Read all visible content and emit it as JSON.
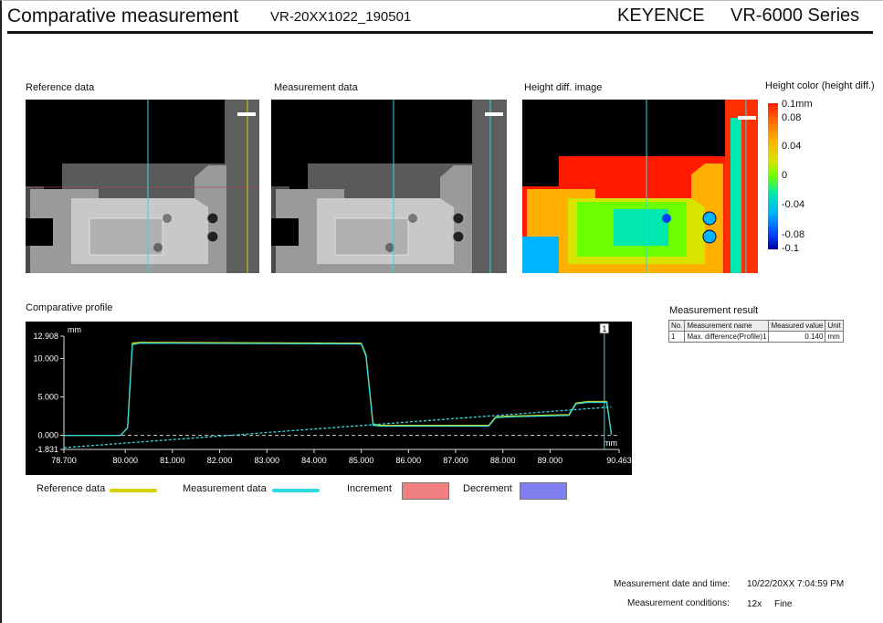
{
  "header": {
    "title": "Comparative measurement",
    "file_id": "VR-20XX1022_190501",
    "brand": "KEYENCE",
    "series": "VR-6000 Series"
  },
  "panels": {
    "reference_label": "Reference data",
    "measurement_label": "Measurement data",
    "height_diff_label": "Height diff. image",
    "color_scale_label": "Height color (height diff.)"
  },
  "color_scale": {
    "ticks": [
      "0.1mm",
      "0.08",
      "0.04",
      "0",
      "-0.04",
      "-0.08",
      "-0.1"
    ],
    "colors": {
      "max": "#ff1a00",
      "zero": "#6dff00",
      "min": "#0000a0"
    }
  },
  "profile": {
    "label": "Comparative profile",
    "unit_y": "mm",
    "unit_x": "mm",
    "marker_label": "1"
  },
  "chart_data": {
    "type": "line",
    "title": "Comparative profile",
    "xlabel": "mm",
    "ylabel": "mm",
    "xlim": [
      78.7,
      90.463
    ],
    "ylim": [
      -1.831,
      12.908
    ],
    "x_ticks": [
      "78.700",
      "80.000",
      "81.000",
      "82.000",
      "83.000",
      "84.000",
      "85.000",
      "86.000",
      "87.000",
      "88.000",
      "89.000",
      "90.463"
    ],
    "y_ticks": [
      "12.908",
      "10.000",
      "5.000",
      "0.000",
      "-1.831"
    ],
    "series": [
      {
        "name": "Reference data",
        "color": "#d8d000",
        "x": [
          78.7,
          79.9,
          80.05,
          80.15,
          80.3,
          85.0,
          85.1,
          85.25,
          85.4,
          87.7,
          87.85,
          88.1,
          89.4,
          89.55,
          89.8,
          90.2,
          90.3
        ],
        "y": [
          0.0,
          0.0,
          1.0,
          12.0,
          12.1,
          12.0,
          10.5,
          1.5,
          1.3,
          1.3,
          2.4,
          2.5,
          2.7,
          4.2,
          4.4,
          4.4,
          0.2
        ]
      },
      {
        "name": "Measurement data",
        "color": "#30d8e0",
        "x": [
          78.7,
          79.9,
          80.05,
          80.15,
          80.3,
          85.0,
          85.1,
          85.25,
          85.4,
          87.7,
          87.85,
          88.1,
          89.4,
          89.55,
          89.8,
          90.2,
          90.3
        ],
        "y": [
          0.0,
          0.0,
          1.0,
          11.8,
          12.0,
          11.9,
          10.3,
          1.3,
          1.2,
          1.2,
          2.3,
          2.4,
          2.6,
          4.1,
          4.3,
          4.3,
          0.1
        ]
      },
      {
        "name": "Measurement data",
        "color": "#30d8e0",
        "x": [
          78.7,
          90.3
        ],
        "y": [
          -1.6,
          3.7
        ]
      }
    ],
    "marker_x": 90.15,
    "grid": false
  },
  "legend": {
    "reference": "Reference data",
    "measurement": "Measurement data",
    "increment": "Increment",
    "decrement": "Decrement",
    "colors": {
      "reference": "#d8d000",
      "measurement": "#30d8e0",
      "increment": "#f08080",
      "decrement": "#8080f0"
    }
  },
  "result": {
    "label": "Measurement result",
    "headers": [
      "No.",
      "Measurement name",
      "Measured value",
      "Unit"
    ],
    "rows": [
      [
        "1",
        "Max. difference(Profile)1",
        "0.140",
        "mm"
      ]
    ]
  },
  "footer": {
    "date_label": "Measurement date and time:",
    "date_value": "10/22/20XX 7:04:59 PM",
    "cond_label": "Measurement conditions:",
    "cond_mag": "12x",
    "cond_mode": "Fine"
  }
}
